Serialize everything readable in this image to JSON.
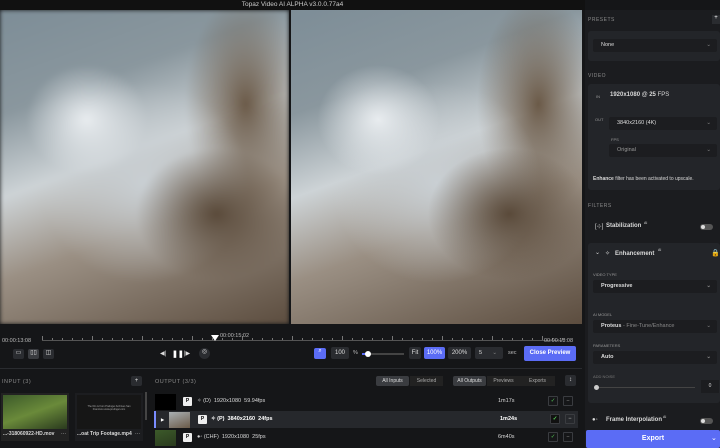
{
  "title": "Topaz Video AI ALPHA  v3.0.0.77a4",
  "timeline": {
    "start": "00:00:13:08",
    "current": "00:00:15:02",
    "end": "00:00:18:08"
  },
  "controls": {
    "zoom_value": "100",
    "zoom_unit": "%",
    "zoom_fraction": 0.1,
    "fit": "Fit",
    "z100": "100%",
    "z200": "200%",
    "duration": "5",
    "duration_unit": "sec",
    "close_preview": "Close Preview"
  },
  "input": {
    "header": "INPUT (3)",
    "add": "+",
    "files": [
      {
        "name": "...-318060922-HD.mov",
        "more": "···"
      },
      {
        "name": "...oat Trip Footage.mp4",
        "more": "···",
        "thumb_text": "The film is from Prelinger Archives San Francisco www.prelinger.com"
      }
    ]
  },
  "output": {
    "header": "OUTPUT (3/3)",
    "filters": [
      "All Inputs",
      "Selected",
      "All Outputs",
      "Previews",
      "Exports"
    ],
    "rows": [
      {
        "badge": "P",
        "model": "(D)",
        "res": "1920x1080",
        "fps": "59.94fps",
        "time": "1m17s"
      },
      {
        "badge": "P",
        "model": "(P)",
        "res": "3840x2160",
        "fps": "24fps",
        "time": "1m24s"
      },
      {
        "badge": "P",
        "model": "(CHF)",
        "res": "1920x1080",
        "fps": "25fps",
        "time": "6m40s"
      }
    ]
  },
  "sidebar": {
    "presets": "PRESETS",
    "preset_value": "None",
    "video": "VIDEO",
    "in": "IN",
    "in_value": "1920x1080 @ 25",
    "in_fps": "FPS",
    "out": "OUT",
    "out_value": "3840x2160 (4K)",
    "fps_label": "FPS",
    "fps_value": "Original",
    "note_bold": "Enhance",
    "note": " filter has been activated to upscale.",
    "filters": "FILTERS",
    "stabilization": "Stabilization",
    "ai": "AI",
    "enhancement": "Enhancement",
    "video_type_label": "VIDEO TYPE",
    "video_type": "Progressive",
    "ai_model_label": "AI MODEL",
    "ai_model": "Proteus",
    "ai_model_sub": " - Fine-Tune/Enhance",
    "parameters_label": "PARAMETERS",
    "parameters": "Auto",
    "add_noise_label": "ADD NOISE",
    "add_noise": "0",
    "frame_interp": "Frame Interpolation",
    "export": "Export"
  },
  "colors": {
    "accent": "#5b6cf5"
  }
}
